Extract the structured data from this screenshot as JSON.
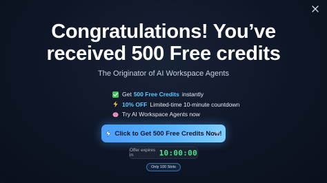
{
  "modal": {
    "headline_line1": "Congratulations! You’ve",
    "headline_line2": "received 500 Free credits",
    "subtitle": "The Originator of AI Workspace Agents",
    "close_icon": "close-icon"
  },
  "features": [
    {
      "icon": "check-mark-icon",
      "prefix": "Get",
      "highlight": "500 Free Credits",
      "suffix": "instantly"
    },
    {
      "icon": "lightning-icon",
      "prefix": "",
      "highlight": "10% OFF",
      "suffix": "Limited-time 10-minute countdown"
    },
    {
      "icon": "brain-icon",
      "prefix": "",
      "highlight": "",
      "suffix": "Try AI Workspace Agents now"
    }
  ],
  "cta": {
    "label": "Click to Get 500 Free Credits Now!",
    "icon": "lightning-icon"
  },
  "timer": {
    "label": "Offer expires in",
    "value": "10:00:00"
  },
  "badge": {
    "label": "Only 100 Slots"
  },
  "colors": {
    "background": "#0e1626",
    "highlight": "#5cc7ff",
    "cta_start": "#4a9ffb",
    "cta_end": "#7fd0ff",
    "timer_value": "#4be08a"
  }
}
